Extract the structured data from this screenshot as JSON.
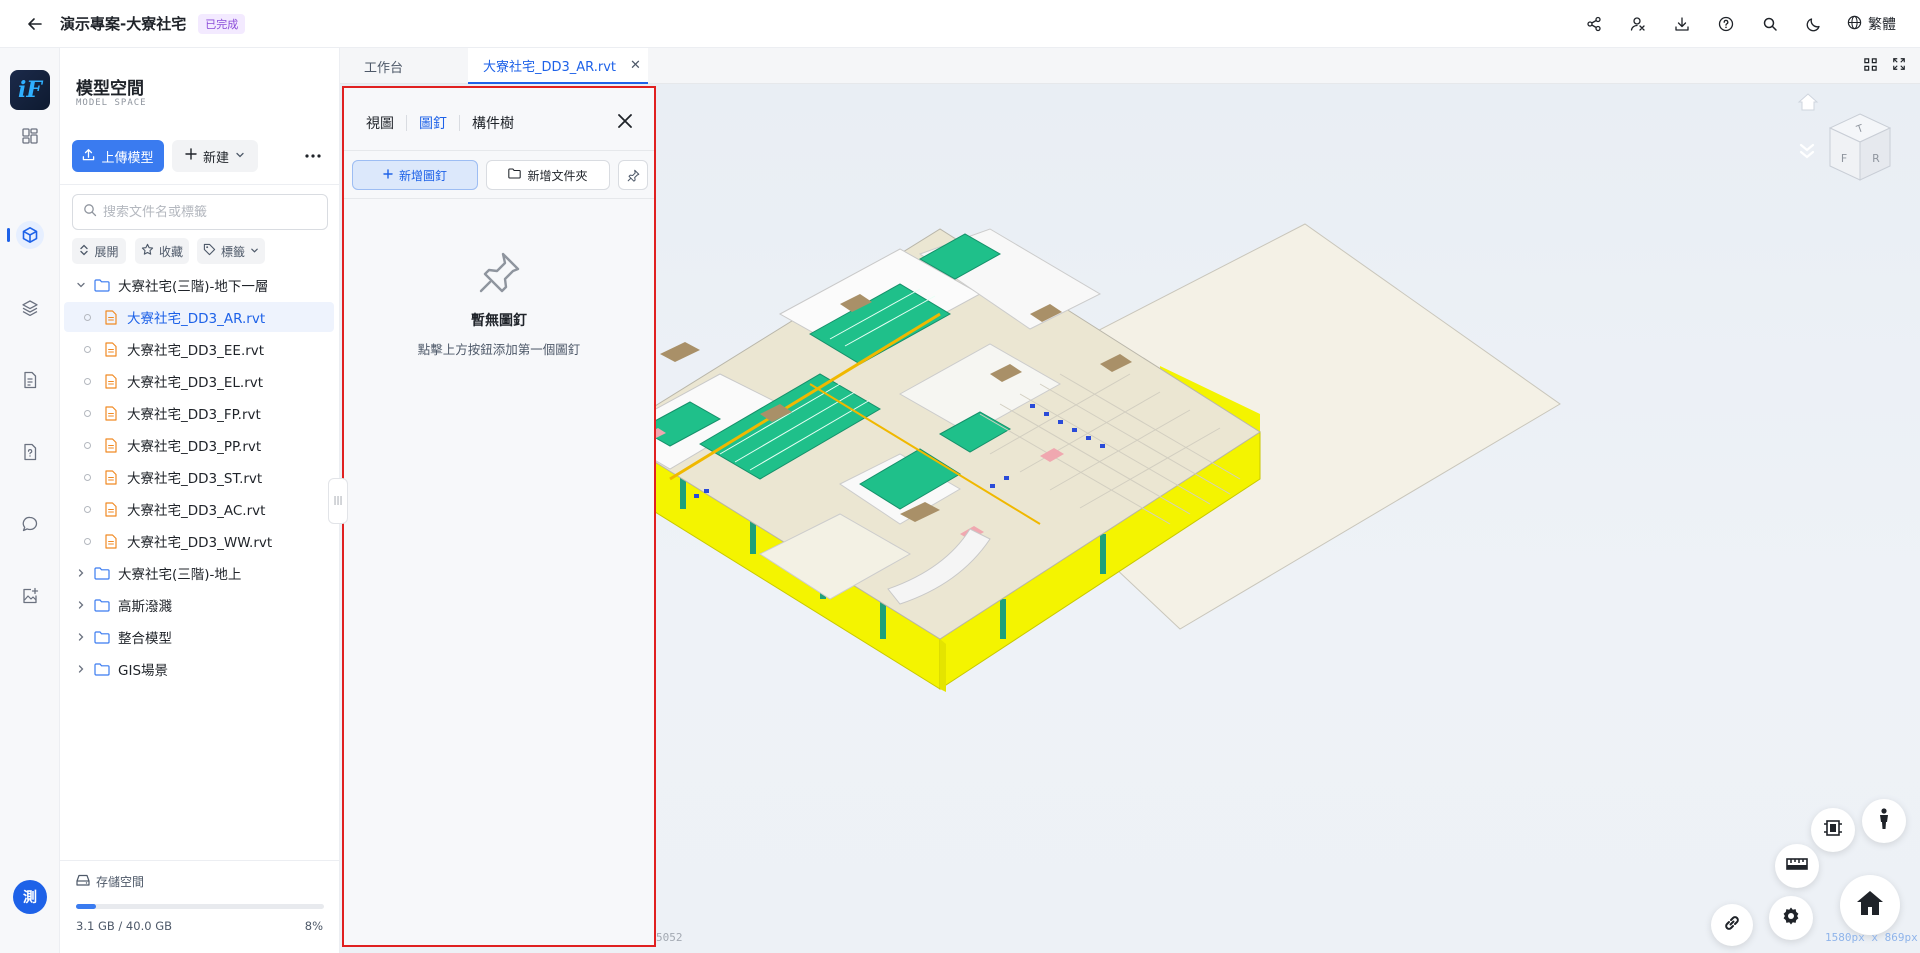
{
  "header": {
    "project_title": "演示專案-大寮社宅",
    "status": "已完成",
    "language": "繁體",
    "icons": [
      "share-icon",
      "user-switch-icon",
      "download-icon",
      "help-icon",
      "search-icon",
      "moon-icon",
      "globe-icon"
    ]
  },
  "rail": {
    "logo": "iF",
    "avatar": "測",
    "items": [
      "dashboard-icon",
      "model-cube-icon",
      "layers-icon",
      "document-icon",
      "file-question-icon",
      "chat-icon",
      "image-add-icon"
    ]
  },
  "model_space": {
    "title": "模型空間",
    "subtitle": "MODEL SPACE",
    "upload_label": "上傳模型",
    "new_label": "新建",
    "search_placeholder": "搜索文件名或標籤",
    "expand_label": "展開",
    "favorite_label": "收藏",
    "tag_label": "標籤",
    "tree": [
      {
        "type": "folder",
        "label": "大寮社宅(三階)-地下一層",
        "expanded": true
      },
      {
        "type": "file",
        "label": "大寮社宅_DD3_AR.rvt",
        "selected": true
      },
      {
        "type": "file",
        "label": "大寮社宅_DD3_EE.rvt"
      },
      {
        "type": "file",
        "label": "大寮社宅_DD3_EL.rvt"
      },
      {
        "type": "file",
        "label": "大寮社宅_DD3_FP.rvt"
      },
      {
        "type": "file",
        "label": "大寮社宅_DD3_PP.rvt"
      },
      {
        "type": "file",
        "label": "大寮社宅_DD3_ST.rvt"
      },
      {
        "type": "file",
        "label": "大寮社宅_DD3_AC.rvt"
      },
      {
        "type": "file",
        "label": "大寮社宅_DD3_WW.rvt"
      },
      {
        "type": "folder",
        "label": "大寮社宅(三階)-地上",
        "expanded": false
      },
      {
        "type": "folder",
        "label": "高斯潑濺",
        "expanded": false
      },
      {
        "type": "folder",
        "label": "整合模型",
        "expanded": false
      },
      {
        "type": "folder",
        "label": "GIS場景",
        "expanded": false
      }
    ],
    "storage": {
      "label": "存儲空間",
      "usage": "3.1 GB / 40.0 GB",
      "percent": "8%",
      "fraction": 0.08
    }
  },
  "tabs": [
    {
      "label": "工作台",
      "active": false
    },
    {
      "label": "大寮社宅_DD3_AR.rvt",
      "active": true
    }
  ],
  "pin_panel": {
    "tabs": [
      "視圖",
      "圖釘",
      "構件樹"
    ],
    "active_tab": "圖釘",
    "add_pin_label": "新增圖釘",
    "add_folder_label": "新增文件夾",
    "empty_title": "暫無圖釘",
    "empty_desc": "點擊上方按鈕添加第一個圖釘"
  },
  "viewport": {
    "coord_left": "5052",
    "coord_right": "1580px x 869px",
    "navcube_faces": [
      "T",
      "F",
      "R"
    ]
  },
  "colors": {
    "accent": "#1e62e8",
    "highlight_border": "#e02020",
    "model_yellow": "#f4f400",
    "model_green": "#1fc08a",
    "model_brown": "#a99068"
  }
}
